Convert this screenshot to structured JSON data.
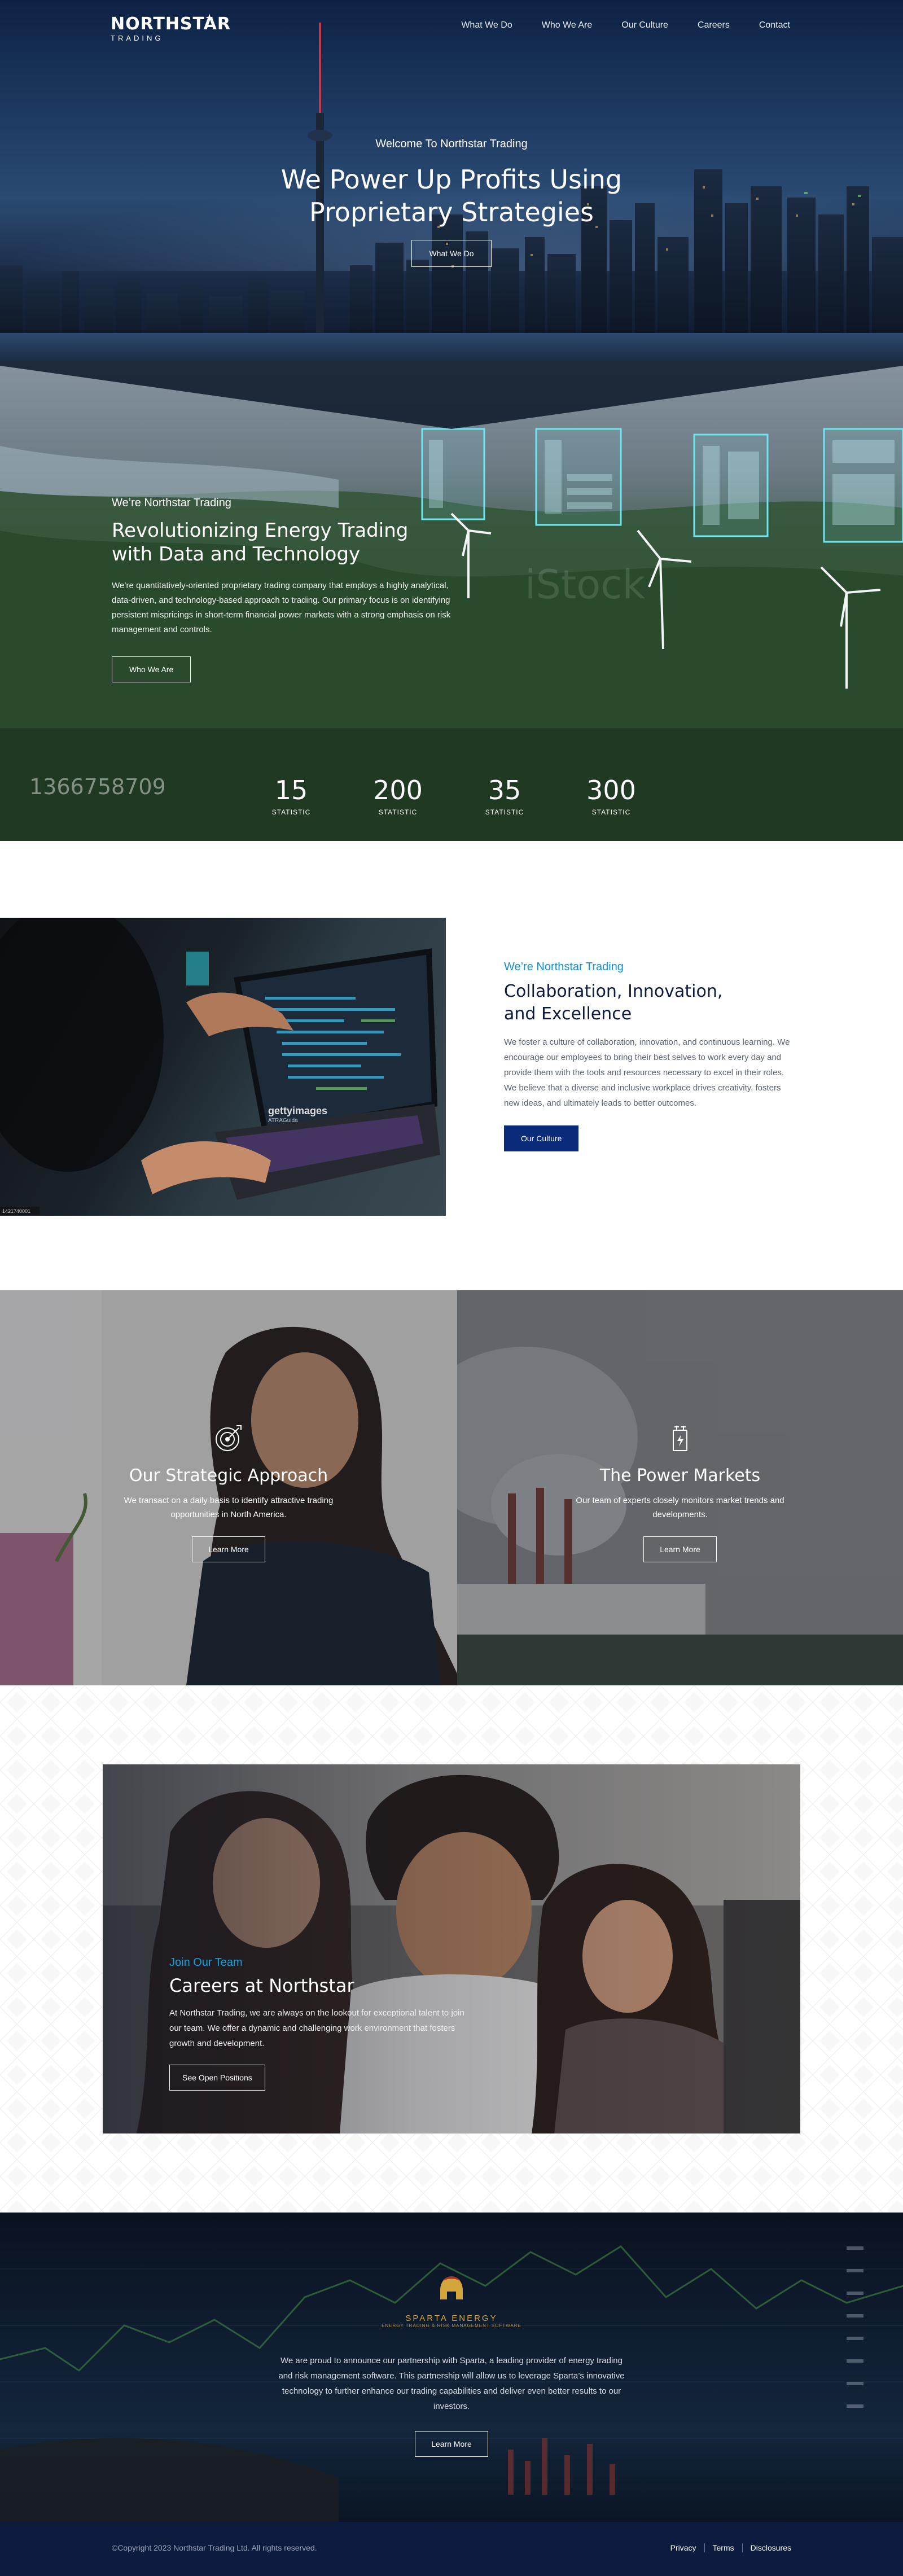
{
  "nav": {
    "logo_main": "NORTHSTAR",
    "logo_sub": "TRADING",
    "items": [
      "What We Do",
      "Who We Are",
      "Our Culture",
      "Careers",
      "Contact"
    ]
  },
  "hero": {
    "eyebrow": "Welcome To Northstar Trading",
    "title_line1": "We Power Up Profits Using",
    "title_line2": "Proprietary Strategies",
    "button": "What We Do"
  },
  "energy": {
    "eyebrow": "We’re Northstar Trading",
    "title_line1": "Revolutionizing Energy Trading",
    "title_line2": "with Data and Technology",
    "body": "We’re quantitatively-oriented proprietary trading company that employs a highly analytical, data-driven, and technology-based approach to trading. Our primary focus is on identifying persistent mispricings in short-term financial power markets with a strong emphasis on risk management and controls.",
    "button": "Who We Are",
    "watermark_number": "1366758709",
    "stats": [
      {
        "value": "15",
        "label": "STATISTIC"
      },
      {
        "value": "200",
        "label": "STATISTIC"
      },
      {
        "value": "35",
        "label": "STATISTIC"
      },
      {
        "value": "300",
        "label": "STATISTIC"
      }
    ]
  },
  "collab": {
    "eyebrow": "We’re Northstar Trading",
    "title_line1": "Collaboration, Innovation,",
    "title_line2": "and Excellence",
    "body": "We foster a culture of collaboration, innovation, and continuous learning. We encourage our employees to bring their best selves to work every day and provide them with the tools and resources necessary to excel in their roles. We believe that a diverse and inclusive workplace drives creativity, fosters new ideas, and ultimately leads to better outcomes.",
    "button": "Our Culture",
    "image_watermark": "gettyimages",
    "image_credit": "ATRAGuida",
    "image_id": "1421740001"
  },
  "tiles": [
    {
      "icon": "target-icon",
      "title": "Our Strategic Approach",
      "body": "We transact on a daily basis to identify attractive trading opportunities in North America.",
      "button": "Learn More"
    },
    {
      "icon": "power-tower-icon",
      "title": "The Power Markets",
      "body": "Our team of experts closely monitors market trends and developments.",
      "button": "Learn More"
    }
  ],
  "careers": {
    "eyebrow": "Join Our Team",
    "title": "Careers at Northstar",
    "body": "At Northstar Trading, we are always on the lookout for exceptional talent to join our team. We offer a dynamic and challenging work environment that fosters growth and development.",
    "button": "See Open Positions"
  },
  "sparta": {
    "logo_text": "SPARTA ENERGY",
    "logo_sub": "ENERGY TRADING & RISK MANAGEMENT SOFTWARE",
    "body": "We are proud to announce our partnership with Sparta, a leading provider of energy trading and risk management software. This partnership will allow us to leverage Sparta’s innovative technology to further enhance our trading capabilities and deliver even better results to our investors.",
    "button": "Learn More"
  },
  "footer": {
    "copyright": "©Copyright 2023 Northstar Trading Ltd. All rights reserved.",
    "links": [
      "Privacy",
      "Terms",
      "Disclosures"
    ]
  },
  "colors": {
    "navy": "#0d1b3e",
    "button_navy": "#0a2a7a",
    "accent_blue": "#0f8fd0",
    "gold": "#d4a53a"
  }
}
